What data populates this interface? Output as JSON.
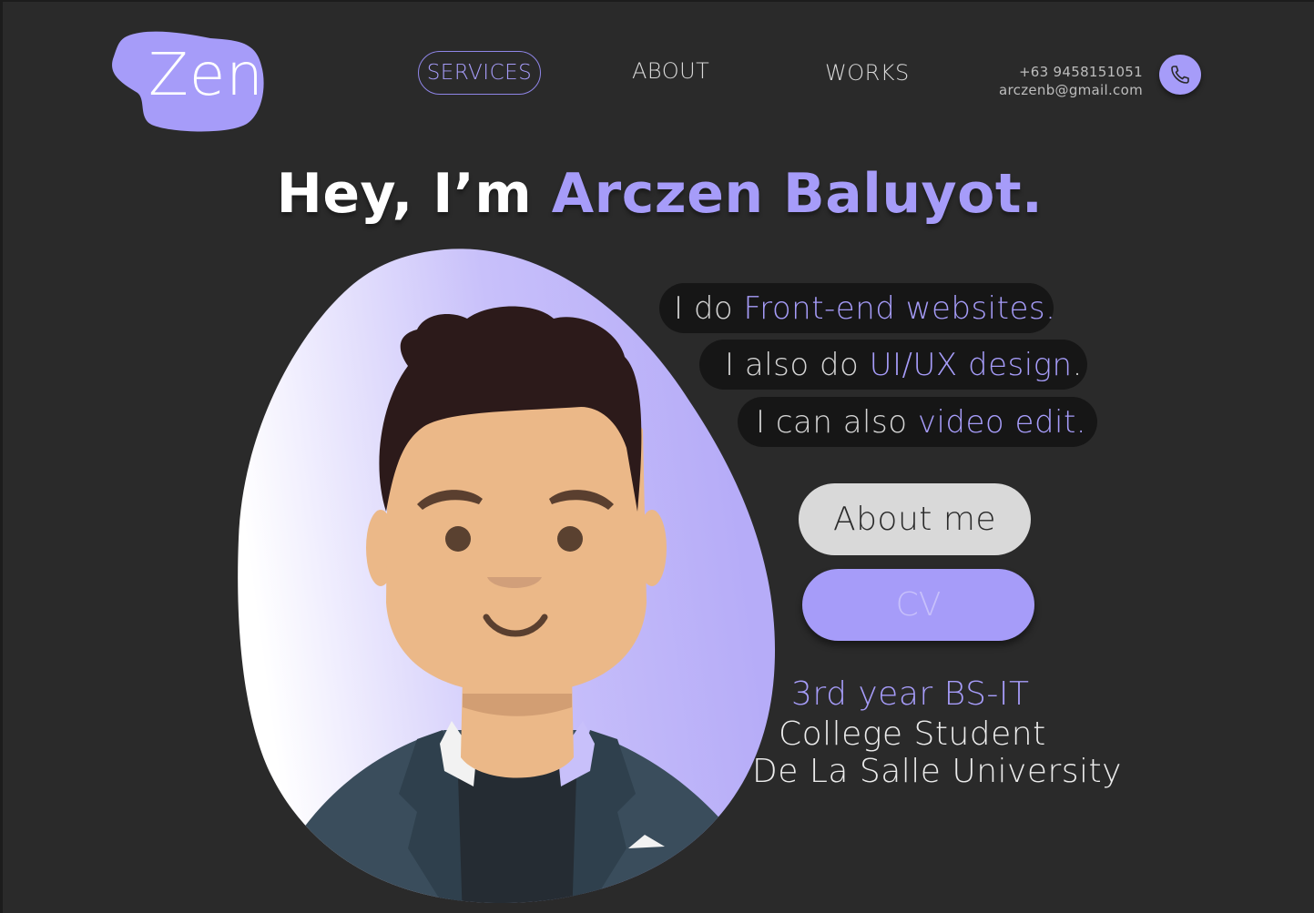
{
  "logo": {
    "text": "Zen"
  },
  "nav": {
    "services": "SERVICES",
    "about": "ABOUT",
    "works": "WORKS"
  },
  "contact": {
    "phone": "+63 9458151051",
    "email": "arczenb@gmail.com",
    "phone_icon": "phone-icon"
  },
  "hero": {
    "greeting": "Hey, I’m ",
    "name": "Arczen Baluyot."
  },
  "skills": [
    {
      "prefix": "I do ",
      "highlight": "Front-end websites.",
      "suffix": ""
    },
    {
      "prefix": "I also do ",
      "highlight": "UI/UX design",
      "suffix": "."
    },
    {
      "prefix": "I can also ",
      "highlight": "video edit.",
      "suffix": ""
    }
  ],
  "buttons": {
    "about_me": "About me",
    "cv": "CV"
  },
  "info": {
    "year": "3rd year BS-IT",
    "status": "College Student",
    "school": "De La Salle University"
  },
  "colors": {
    "accent": "#a69cf9",
    "background": "#2a2a2a",
    "pill": "#161616"
  }
}
